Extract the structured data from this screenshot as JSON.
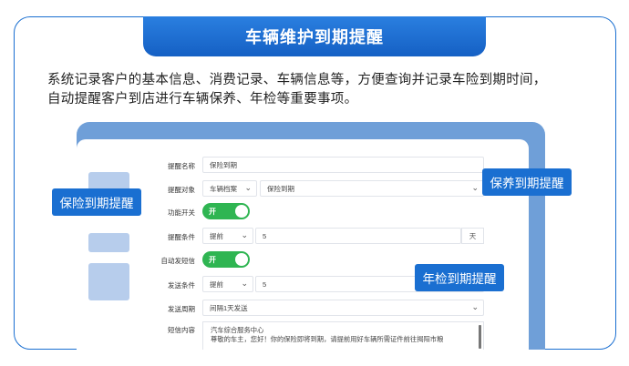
{
  "title": "车辆维护到期提醒",
  "description": {
    "line1": "系统记录客户的基本信息、消费记录、车辆信息等，方便查询并记录车险到期时间，",
    "line2": "自动提醒客户到店进行车辆保养、年检等重要事项。"
  },
  "form": {
    "reminder_name": {
      "label": "提醒名称",
      "value": "保险到期"
    },
    "reminder_target": {
      "label": "提醒对象",
      "category": "车辆档案",
      "value": "保险到期"
    },
    "function_switch": {
      "label": "功能开关",
      "state": "开"
    },
    "reminder_condition": {
      "label": "提醒条件",
      "mode": "提前",
      "value": "5",
      "unit": "天"
    },
    "auto_sms": {
      "label": "自动发短信",
      "state": "开"
    },
    "send_condition": {
      "label": "发送条件",
      "mode": "提前",
      "value": "5"
    },
    "send_cycle": {
      "label": "发送周期",
      "value": "间隔1天发送"
    },
    "sms_content": {
      "label": "短信内容",
      "line1": "汽车综合服务中心",
      "line2": "尊敬的车主，您好！你的保险即将到期，请提前用好车辆所需证件前往揭阳市粮"
    }
  },
  "callouts": {
    "insurance": "保险到期提醒",
    "maintenance": "保养到期提醒",
    "inspection": "年检到期提醒"
  },
  "colors": {
    "brand_blue": "#1a6fd1",
    "toggle_green": "#2fb552",
    "frame_blue": "#6f9fd8"
  },
  "icons": {
    "dropdown": "chevron-down-icon"
  }
}
